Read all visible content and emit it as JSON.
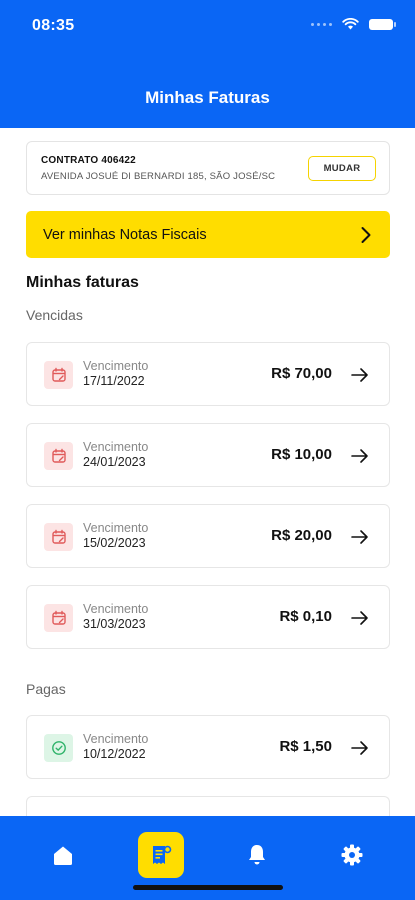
{
  "status_bar": {
    "time": "08:35"
  },
  "header": {
    "title": "Minhas Faturas"
  },
  "contract": {
    "title": "CONTRATO 406422",
    "address": "AVENIDA JOSUÉ DI BERNARDI 185, SÃO JOSÉ/SC",
    "change_label": "MUDAR"
  },
  "notes_banner": {
    "label": "Ver minhas Notas Fiscais"
  },
  "invoices": {
    "section_title": "Minhas faturas",
    "overdue_label": "Vencidas",
    "paid_label": "Pagas",
    "overdue": [
      {
        "label": "Vencimento",
        "date": "17/11/2022",
        "amount": "R$ 70,00"
      },
      {
        "label": "Vencimento",
        "date": "24/01/2023",
        "amount": "R$ 10,00"
      },
      {
        "label": "Vencimento",
        "date": "15/02/2023",
        "amount": "R$ 20,00"
      },
      {
        "label": "Vencimento",
        "date": "31/03/2023",
        "amount": "R$ 0,10"
      }
    ],
    "paid": [
      {
        "label": "Vencimento",
        "date": "10/12/2022",
        "amount": "R$ 1,50"
      }
    ]
  },
  "bottom_nav": {
    "items": [
      "home-icon",
      "invoice-icon",
      "bell-icon",
      "gear-icon"
    ],
    "active": "invoice-icon"
  },
  "colors": {
    "primary": "#0A66F5",
    "accent": "#FFDD00",
    "overdue_bg": "#FCE4E4",
    "overdue_icon": "#E05A5A",
    "paid_bg": "#DDF5E6",
    "paid_icon": "#2FB36A"
  }
}
